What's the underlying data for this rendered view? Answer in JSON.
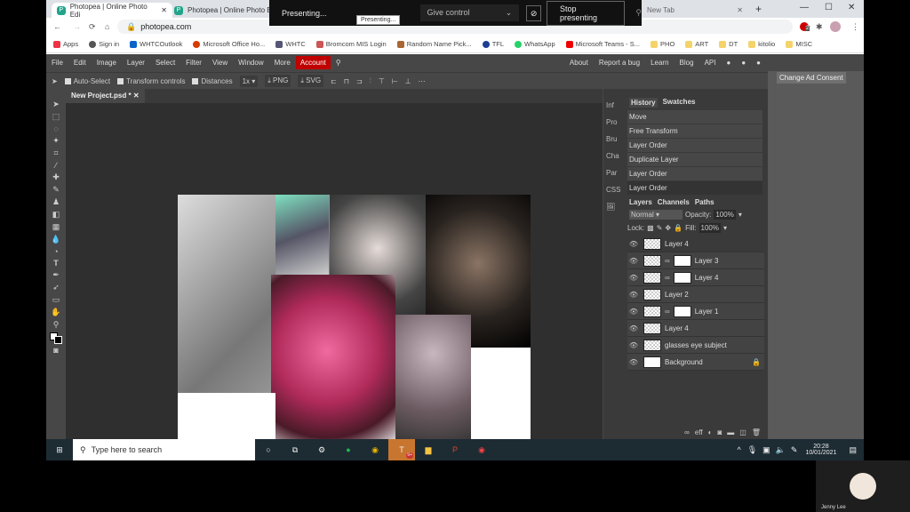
{
  "browser": {
    "tabs": [
      {
        "title": "Photopea | Online Photo Edi",
        "active": true
      },
      {
        "title": "Photopea | Online Photo Edi",
        "active": false
      },
      {
        "title": "New Tab",
        "active": false
      }
    ],
    "url": "photopea.com",
    "bookmarks": [
      "Apps",
      "Sign in",
      "WHTCOutlook",
      "Microsoft Office Ho...",
      "WHTC",
      "Bromcom MIS Login",
      "Random Name Pick...",
      "TFL",
      "WhatsApp",
      "Microsoft Teams - S...",
      "PHO",
      "ART",
      "DT",
      "kitolio",
      "MISC"
    ],
    "extension_badge": "2"
  },
  "presenting": {
    "status": "Presenting...",
    "tooltip": "Presenting...",
    "give_control": "Give control",
    "stop": "Stop presenting"
  },
  "photopea": {
    "menu": [
      "File",
      "Edit",
      "Image",
      "Layer",
      "Select",
      "Filter",
      "View",
      "Window",
      "More"
    ],
    "account": "Account",
    "right_links": [
      "About",
      "Report a bug",
      "Learn",
      "Blog",
      "API"
    ],
    "options": {
      "auto_select": "Auto-Select",
      "transform_controls": "Transform controls",
      "distances": "Distances",
      "zoom": "1x",
      "png": "PNG",
      "svg": "SVG"
    },
    "doc_tab": "New Project.psd *",
    "side_tabs": [
      "Inf",
      "Pro",
      "Bru",
      "Cha",
      "Par",
      "CSS"
    ],
    "history_tabs": [
      "History",
      "Swatches"
    ],
    "history": [
      "Move",
      "Free Transform",
      "Layer Order",
      "Duplicate Layer",
      "Layer Order",
      "Layer Order"
    ],
    "layer_tabs": [
      "Layers",
      "Channels",
      "Paths"
    ],
    "blend_mode": "Normal",
    "opacity_label": "Opacity:",
    "opacity": "100%",
    "lock_label": "Lock:",
    "fill_label": "Fill:",
    "fill": "100%",
    "layers": [
      {
        "name": "Layer 4",
        "mask": false,
        "selected": true
      },
      {
        "name": "Layer 3",
        "mask": true
      },
      {
        "name": "Layer 4",
        "mask": true
      },
      {
        "name": "Layer 2",
        "mask": false
      },
      {
        "name": "Layer 1",
        "mask": true
      },
      {
        "name": "Layer 4",
        "mask": false
      },
      {
        "name": "glasses eye subject",
        "mask": false
      },
      {
        "name": "Background",
        "mask": false,
        "locked": true
      }
    ],
    "ad_consent": "Change Ad Consent",
    "accent": "#c00000"
  },
  "taskbar": {
    "search_placeholder": "Type here to search",
    "time": "20:28",
    "date": "10/01/2021",
    "teams_badge": "9+"
  },
  "video": {
    "name": "Jenny Lee"
  }
}
